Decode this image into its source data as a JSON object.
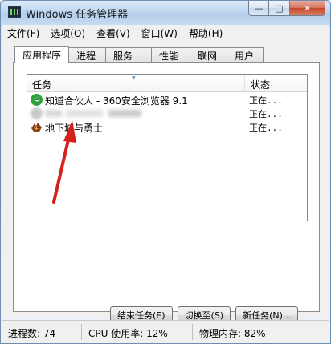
{
  "window": {
    "title": "Windows 任务管理器",
    "caption_buttons": [
      "—",
      "□",
      "✕"
    ]
  },
  "menu": [
    "文件(F)",
    "选项(O)",
    "查看(V)",
    "窗口(W)",
    "帮助(H)"
  ],
  "tabs": [
    "应用程序",
    "进程",
    "服务",
    "性能",
    "联网",
    "用户"
  ],
  "active_tab": "应用程序",
  "list": {
    "columns": [
      "任务",
      "状态"
    ],
    "rows": [
      {
        "icon": "ie-browser-icon",
        "name": "知道合伙人 - 360安全浏览器 9.1",
        "status": "正在..."
      },
      {
        "icon": "blurred-app-icon",
        "name": "",
        "status": "正在..."
      },
      {
        "icon": "game-icon",
        "name": "地下城与勇士",
        "status": "正在..."
      }
    ]
  },
  "buttons": {
    "end_task": "结束任务(E)",
    "switch_to": "切换至(S)",
    "new_task": "新任务(N)..."
  },
  "statusbar": {
    "processes": "进程数: 74",
    "cpu": "CPU 使用率: 12%",
    "memory": "物理内存: 82%"
  },
  "annotation_color": "#d6201b"
}
